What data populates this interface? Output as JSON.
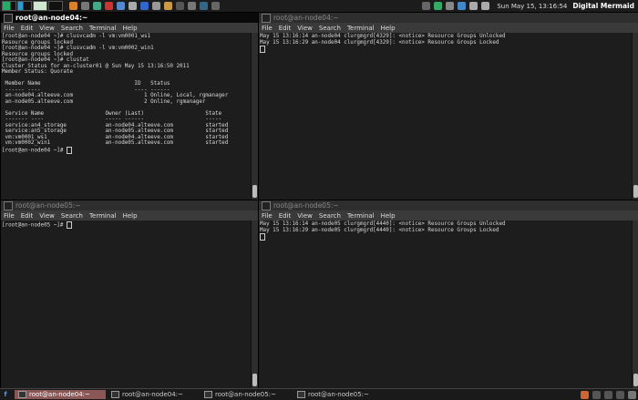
{
  "top_panel": {
    "clock": "Sun May 15, 13:16:54",
    "user": "Digital Mermaid"
  },
  "windows": [
    {
      "id": "node04-main",
      "title": "root@an-node04:~",
      "active": true,
      "menu": [
        "File",
        "Edit",
        "View",
        "Search",
        "Terminal",
        "Help"
      ],
      "lines": [
        "[root@an-node04 ~]# clusvcadm -l vm:vm0001_ws1",
        "Resource groups locked",
        "[root@an-node04 ~]# clusvcadm -l vm:vm0002_win1",
        "Resource groups locked",
        "[root@an-node04 ~]# clustat",
        "Cluster Status for an-cluster01 @ Sun May 15 13:16:50 2011",
        "Member Status: Quorate",
        "",
        " Member Name                             ID   Status",
        " ------ ----                             ---- ------",
        " an-node04.alteeve.com                      1 Online, Local, rgmanager",
        " an-node05.alteeve.com                      2 Online, rgmanager",
        "",
        " Service Name                   Owner (Last)                   State",
        " ------- ----                   ----- ------                   -----",
        " service:an4_storage            an-node04.alteeve.com          started",
        " service:an5_storage            an-node05.alteeve.com          started",
        " vm:vm0001_ws1                  an-node04.alteeve.com          started",
        " vm:vm0002_win1                 an-node05.alteeve.com          started",
        "[root@an-node04 ~]# "
      ]
    },
    {
      "id": "node04-log",
      "title": "root@an-node04:~",
      "active": false,
      "menu": [
        "File",
        "Edit",
        "View",
        "Search",
        "Terminal",
        "Help"
      ],
      "lines": [
        "May 15 13:16:14 an-node04 clurgmgrd[4329]: <notice> Resource Groups Unlocked",
        "May 15 13:16:29 an-node04 clurgmgrd[4329]: <notice> Resource Groups Locked"
      ]
    },
    {
      "id": "node05-main",
      "title": "root@an-node05:~",
      "active": false,
      "menu": [
        "File",
        "Edit",
        "View",
        "Search",
        "Terminal",
        "Help"
      ],
      "lines": [
        "[root@an-node05 ~]# "
      ]
    },
    {
      "id": "node05-log",
      "title": "root@an-node05:~",
      "active": false,
      "menu": [
        "File",
        "Edit",
        "View",
        "Search",
        "Terminal",
        "Help"
      ],
      "lines": [
        "May 15 13:16:14 an-node05 clurgmgrd[4440]: <notice> Resource Groups Unlocked",
        "May 15 13:16:29 an-node05 clurgmgrd[4440]: <notice> Resource Groups Locked"
      ]
    }
  ],
  "taskbar": {
    "tasks": [
      {
        "label": "root@an-node04:~",
        "active": true
      },
      {
        "label": "root@an-node04:~",
        "active": false
      },
      {
        "label": "root@an-node05:~",
        "active": false
      },
      {
        "label": "root@an-node05:~",
        "active": false
      }
    ]
  },
  "colors": {
    "active_task": "#8a5656",
    "terminal_bg": "#1d1d1d",
    "terminal_fg": "#d8d8d8"
  }
}
